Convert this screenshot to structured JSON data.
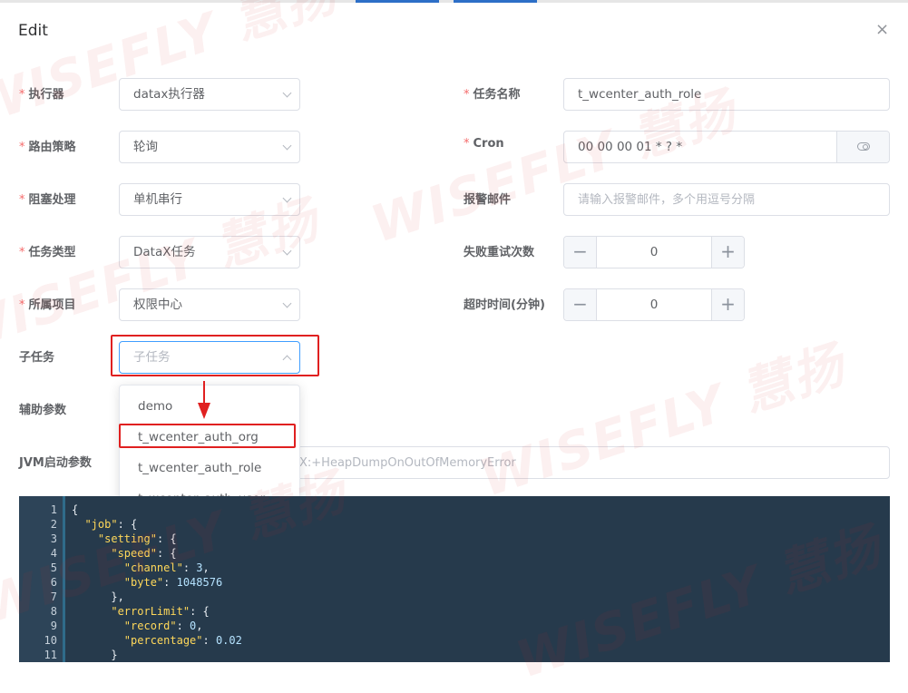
{
  "dialog": {
    "title": "Edit",
    "close_icon": "×"
  },
  "form": {
    "executor": {
      "label": "执行器",
      "value": "datax执行器"
    },
    "task_name": {
      "label": "任务名称",
      "value": "t_wcenter_auth_role"
    },
    "route_strategy": {
      "label": "路由策略",
      "value": "轮询"
    },
    "cron": {
      "label": "Cron",
      "value": "00 00 00 01 * ? *"
    },
    "block_strategy": {
      "label": "阻塞处理",
      "value": "单机串行"
    },
    "alarm_email": {
      "label": "报警邮件",
      "placeholder": "请输入报警邮件，多个用逗号分隔"
    },
    "task_type": {
      "label": "任务类型",
      "value": "DataX任务"
    },
    "retry_count": {
      "label": "失败重试次数",
      "value": "0",
      "dec": "−",
      "inc": "+"
    },
    "project": {
      "label": "所属项目",
      "value": "权限中心"
    },
    "timeout": {
      "label": "超时时间(分钟)",
      "value": "0",
      "dec": "−",
      "inc": "+"
    },
    "subtask": {
      "label": "子任务",
      "placeholder": "子任务"
    },
    "aux_params": {
      "label": "辅助参数"
    },
    "jvm_params": {
      "label": "JVM启动参数",
      "placeholder_visible": "X:+HeapDumpOnOutOfMemoryError"
    }
  },
  "dropdown": {
    "options": [
      "demo",
      "t_wcenter_auth_org",
      "t_wcenter_auth_role",
      "t_wcenter_auth_user"
    ]
  },
  "editor": {
    "line_numbers": [
      "1",
      "2",
      "3",
      "4",
      "5",
      "6",
      "7",
      "8",
      "9",
      "10",
      "11"
    ]
  },
  "watermark": {
    "text": "WISEFLY 慧扬"
  },
  "colors": {
    "required": "#f56c6c",
    "highlight": "#e02020",
    "focus": "#409eff",
    "editor_bg": "#263a4c"
  }
}
